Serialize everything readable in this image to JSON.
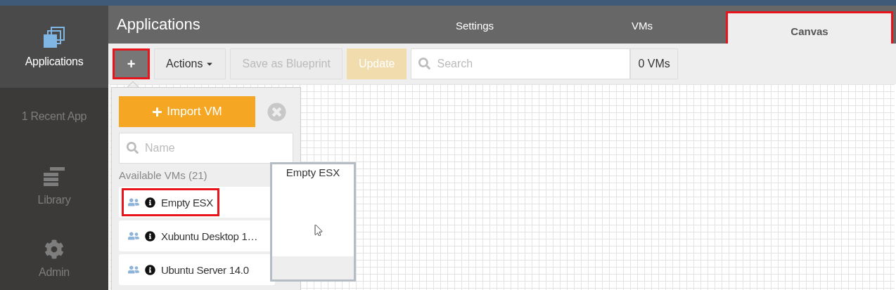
{
  "sidebar": {
    "items": [
      {
        "label": "Applications",
        "kind": "apps",
        "selected": true
      },
      {
        "label": "1 Recent App",
        "kind": "text",
        "selected": false
      },
      {
        "label": "Library",
        "kind": "library",
        "selected": false
      },
      {
        "label": "Admin",
        "kind": "gear",
        "selected": false
      }
    ]
  },
  "header": {
    "title": "Applications",
    "tabs": [
      {
        "label": "Settings",
        "selected": false,
        "highlighted": false
      },
      {
        "label": "VMs",
        "selected": false,
        "highlighted": false
      },
      {
        "label": "Canvas",
        "selected": true,
        "highlighted": true
      }
    ]
  },
  "toolbar": {
    "add_button": {
      "label": "+",
      "highlighted": true
    },
    "actions_button": "Actions",
    "save_button": {
      "label": "Save as Blueprint",
      "disabled": true
    },
    "update_button": {
      "label": "Update",
      "disabled": true
    },
    "search": {
      "placeholder": "Search"
    },
    "vm_count": "0 VMs"
  },
  "import_panel": {
    "import_button": "Import VM",
    "search": {
      "placeholder": "Name"
    },
    "heading": "Available VMs (21)",
    "items": [
      {
        "name": "Empty ESX",
        "highlighted": true
      },
      {
        "name": "Xubuntu Desktop 1…",
        "highlighted": false
      },
      {
        "name": "Ubuntu Server 14.0",
        "highlighted": false
      }
    ]
  },
  "preview": {
    "title": "Empty ESX"
  }
}
